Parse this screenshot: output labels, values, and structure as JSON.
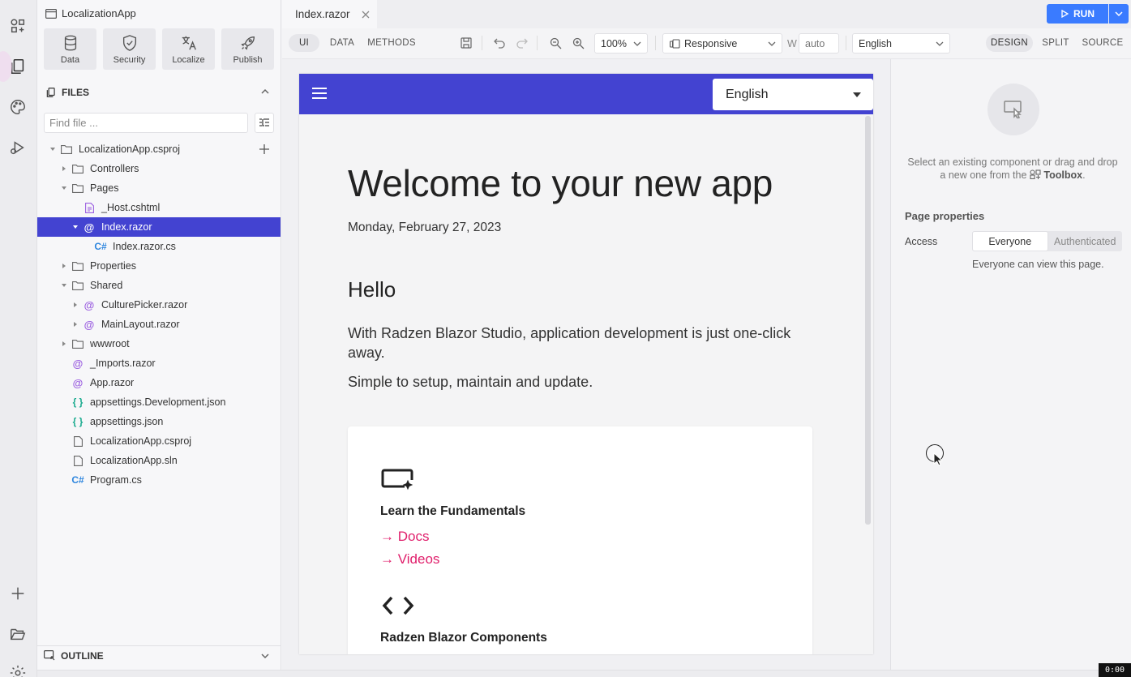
{
  "project": {
    "title": "LocalizationApp"
  },
  "quick_actions": [
    {
      "label": "Data",
      "icon": "database-icon"
    },
    {
      "label": "Security",
      "icon": "shield-icon"
    },
    {
      "label": "Localize",
      "icon": "translate-icon"
    },
    {
      "label": "Publish",
      "icon": "rocket-icon"
    }
  ],
  "files": {
    "header": "FILES",
    "search_placeholder": "Find file ...",
    "tree": [
      {
        "label": "LocalizationApp.csproj",
        "type": "folder",
        "expanded": true
      },
      {
        "label": "Controllers",
        "type": "folder",
        "expanded": false
      },
      {
        "label": "Pages",
        "type": "folder",
        "expanded": true
      },
      {
        "label": "_Host.cshtml",
        "type": "cshtml"
      },
      {
        "label": "Index.razor",
        "type": "razor",
        "expanded": true,
        "selected": true
      },
      {
        "label": "Index.razor.cs",
        "type": "cs"
      },
      {
        "label": "Properties",
        "type": "folder",
        "expanded": false
      },
      {
        "label": "Shared",
        "type": "folder",
        "expanded": true
      },
      {
        "label": "CulturePicker.razor",
        "type": "razor",
        "expanded": false
      },
      {
        "label": "MainLayout.razor",
        "type": "razor",
        "expanded": false
      },
      {
        "label": "wwwroot",
        "type": "folder",
        "expanded": false
      },
      {
        "label": "_Imports.razor",
        "type": "razor"
      },
      {
        "label": "App.razor",
        "type": "razor"
      },
      {
        "label": "appsettings.Development.json",
        "type": "json"
      },
      {
        "label": "appsettings.json",
        "type": "json"
      },
      {
        "label": "LocalizationApp.csproj",
        "type": "file"
      },
      {
        "label": "LocalizationApp.sln",
        "type": "file"
      },
      {
        "label": "Program.cs",
        "type": "cs"
      }
    ]
  },
  "outline": {
    "header": "OUTLINE"
  },
  "tabs": {
    "active": "Index.razor"
  },
  "run": {
    "label": "RUN"
  },
  "toolbar": {
    "modes": [
      "UI",
      "DATA",
      "METHODS"
    ],
    "active_mode": "UI",
    "zoom": "100%",
    "device": "Responsive",
    "width_label": "W",
    "width_placeholder": "auto",
    "language": "English",
    "views": [
      "DESIGN",
      "SPLIT",
      "SOURCE"
    ],
    "active_view": "DESIGN"
  },
  "canvas": {
    "header_language": "English",
    "welcome": "Welcome to your new app",
    "date": "Monday, February 27, 2023",
    "hello": "Hello",
    "para1": "With Radzen Blazor Studio, application development is just one-click away.",
    "para2": "Simple to setup, maintain and update.",
    "card": {
      "section1_title": "Learn the Fundamentals",
      "link_docs": "→ Docs",
      "link_videos": "→ Videos",
      "section2_title": "Radzen Blazor Components"
    }
  },
  "properties": {
    "hint_text": "Select an existing component or drag and drop a new one from the",
    "hint_toolbox": "Toolbox",
    "hint_end": ".",
    "page_properties_title": "Page properties",
    "access_label": "Access",
    "access_options": [
      "Everyone",
      "Authenticated"
    ],
    "access_selected": "Everyone",
    "access_note": "Everyone can view this page."
  },
  "badge": "0:00",
  "colors": {
    "accent": "#4343d1",
    "run": "#3a7bff",
    "link": "#e01e6b"
  }
}
